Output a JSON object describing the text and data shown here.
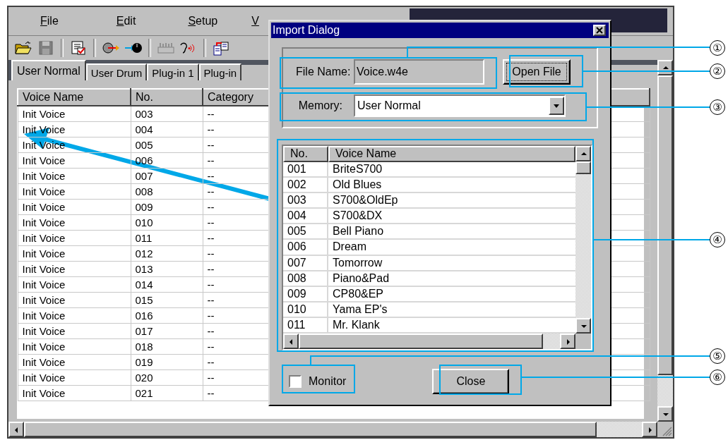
{
  "main_window": {
    "menu": [
      "File",
      "Edit",
      "Setup",
      "V"
    ],
    "tabs": [
      {
        "label": "User Normal",
        "selected": true
      },
      {
        "label": "User Drum",
        "selected": false
      },
      {
        "label": "Plug-in 1",
        "selected": false
      },
      {
        "label": "Plug-in",
        "selected": false
      }
    ],
    "table": {
      "columns": [
        "Voice Name",
        "No.",
        "Category"
      ],
      "rows": [
        [
          "Init Voice",
          "003",
          "--"
        ],
        [
          "Init Voice",
          "004",
          "--"
        ],
        [
          "Init Voice",
          "005",
          "--"
        ],
        [
          "Init Voice",
          "006",
          "--"
        ],
        [
          "Init Voice",
          "007",
          "--"
        ],
        [
          "Init Voice",
          "008",
          "--"
        ],
        [
          "Init Voice",
          "009",
          "--"
        ],
        [
          "Init Voice",
          "010",
          "--"
        ],
        [
          "Init Voice",
          "011",
          "--"
        ],
        [
          "Init Voice",
          "012",
          "--"
        ],
        [
          "Init Voice",
          "013",
          "--"
        ],
        [
          "Init Voice",
          "014",
          "--"
        ],
        [
          "Init Voice",
          "015",
          "--"
        ],
        [
          "Init Voice",
          "016",
          "--"
        ],
        [
          "Init Voice",
          "017",
          "--"
        ],
        [
          "Init Voice",
          "018",
          "--"
        ],
        [
          "Init Voice",
          "019",
          "--"
        ],
        [
          "Init Voice",
          "020",
          "--"
        ],
        [
          "Init Voice",
          "021",
          "--"
        ]
      ]
    }
  },
  "dialog": {
    "title": "Import Dialog",
    "file_name": {
      "label": "File Name:",
      "value": "Voice.w4e"
    },
    "open_file_button": "Open File",
    "memory": {
      "label": "Memory:",
      "value": "User Normal"
    },
    "voice_list": {
      "columns": [
        "No.",
        "Voice Name"
      ],
      "rows": [
        [
          "001",
          "BriteS700"
        ],
        [
          "002",
          "Old Blues"
        ],
        [
          "003",
          "S700&OldEp"
        ],
        [
          "004",
          "S700&DX"
        ],
        [
          "005",
          "Bell Piano"
        ],
        [
          "006",
          "Dream"
        ],
        [
          "007",
          "Tomorrow"
        ],
        [
          "008",
          "Piano&Pad"
        ],
        [
          "009",
          "CP80&EP"
        ],
        [
          "010",
          "Yama EP's"
        ],
        [
          "011",
          "Mr. Klank"
        ]
      ]
    },
    "monitor": {
      "label": "Monitor",
      "checked": false
    },
    "close_button": "Close"
  },
  "callouts": [
    "①",
    "②",
    "③",
    "④",
    "⑤",
    "⑥"
  ]
}
